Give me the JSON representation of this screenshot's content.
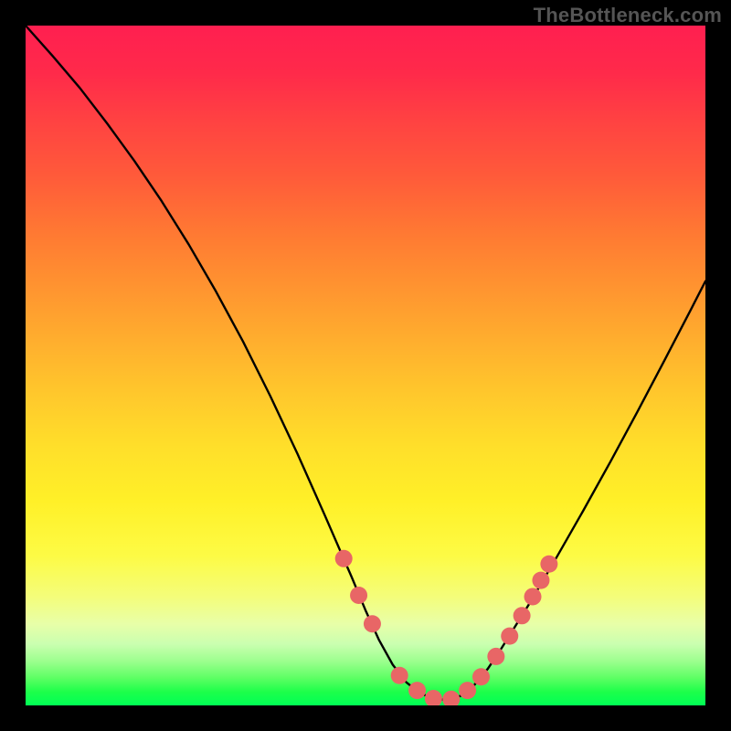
{
  "watermark": "TheBottleneck.com",
  "colors": {
    "frame_bg": "#000000",
    "dot_fill": "#e86666",
    "curve_stroke": "#000000",
    "gradient_top": "#ff1f50",
    "gradient_bottom": "#00ff55"
  },
  "chart_data": {
    "type": "line",
    "title": "",
    "xlabel": "",
    "ylabel": "",
    "xlim": [
      0,
      100
    ],
    "ylim": [
      0,
      100
    ],
    "grid": false,
    "series": [
      {
        "name": "bottleneck-curve",
        "x": [
          0,
          4,
          8,
          12,
          16,
          20,
          24,
          28,
          32,
          36,
          40,
          44,
          48,
          50,
          52,
          54,
          56,
          58,
          60,
          62,
          64,
          66,
          68,
          70,
          74,
          78,
          82,
          86,
          90,
          94,
          98,
          100
        ],
        "y": [
          100,
          95.5,
          90.8,
          85.6,
          80.1,
          74.2,
          67.8,
          60.9,
          53.5,
          45.5,
          37.0,
          28.0,
          18.8,
          14.0,
          9.6,
          6.0,
          3.4,
          1.8,
          1.0,
          0.8,
          1.4,
          3.0,
          5.4,
          8.4,
          14.8,
          21.6,
          28.6,
          35.8,
          43.2,
          50.8,
          58.5,
          62.4
        ]
      }
    ],
    "highlighted_points": {
      "name": "threshold-dots",
      "x": [
        46.8,
        49.0,
        51.0,
        55.0,
        57.6,
        60.0,
        62.6,
        65.0,
        67.0,
        69.2,
        71.2,
        73.0,
        74.6,
        75.8,
        77.0
      ],
      "y": [
        21.6,
        16.2,
        12.0,
        4.4,
        2.2,
        1.0,
        0.9,
        2.2,
        4.2,
        7.2,
        10.2,
        13.2,
        16.0,
        18.4,
        20.8
      ]
    }
  }
}
